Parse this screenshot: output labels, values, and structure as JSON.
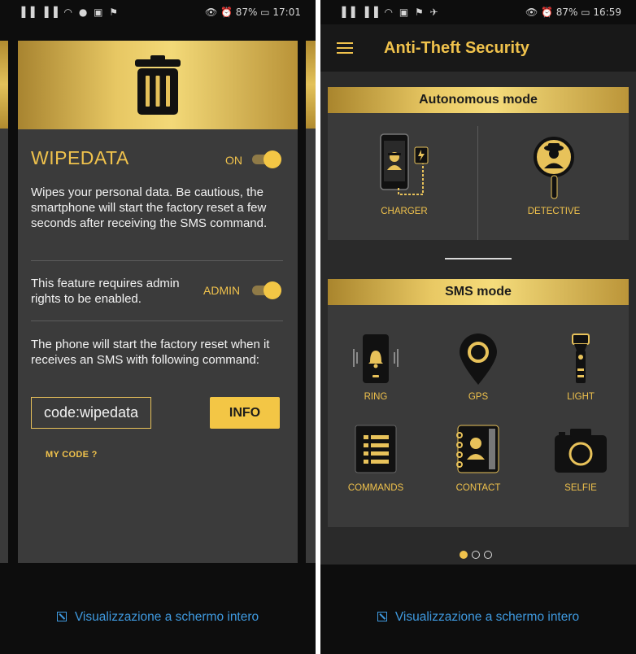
{
  "left": {
    "statusbar": {
      "signal": "▐▐ ▐▐ ◠ ● ▣ ⚑",
      "right": "👁 ⏰ 87% ▭ 17:01"
    },
    "feature_title": "WIPEDATA",
    "toggle_label": "ON",
    "description": "Wipes your personal data. Be cautious, the smartphone will start the factory reset a few seconds after receiving the SMS command.",
    "admin_text": "This feature requires admin rights to be enabled.",
    "admin_label": "ADMIN",
    "sms_text": "The phone will start the factory reset when it receives an SMS with following command:",
    "code_value": "code:wipedata",
    "info_label": "INFO",
    "mycode_label": "MY CODE ?",
    "fullscreen_label": "Visualizzazione a schermo intero"
  },
  "right": {
    "statusbar": {
      "signal": "▐▐ ▐▐ ◠ ▣ ⚑ ✈",
      "right": "👁 ⏰ 87% ▭ 16:59"
    },
    "app_title": "Anti-Theft Security",
    "autonomous_title": "Autonomous mode",
    "charger_label": "CHARGER",
    "detective_label": "DETECTIVE",
    "sms_title": "SMS mode",
    "sms_items": [
      "RING",
      "GPS",
      "LIGHT",
      "COMMANDS",
      "CONTACT",
      "SELFIE"
    ],
    "fullscreen_label": "Visualizzazione a schermo intero"
  },
  "colors": {
    "gold": "#f0c24c",
    "dark": "#3a3a3a",
    "link": "#3f9ae0"
  }
}
